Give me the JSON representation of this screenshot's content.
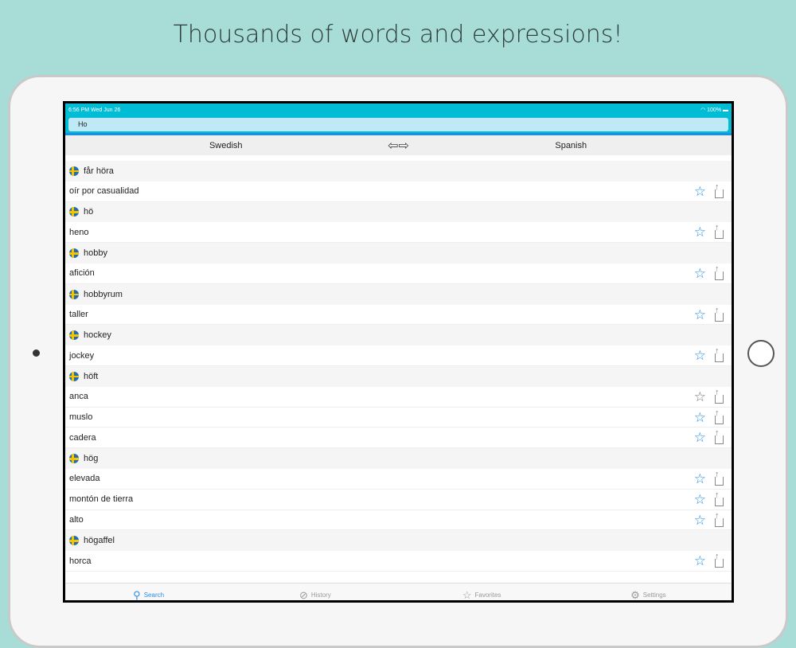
{
  "headline": "Thousands of words and expressions!",
  "status": {
    "time": "6:56 PM  Wed Jun 26",
    "battery": "100%"
  },
  "search": {
    "value": "Ho"
  },
  "languages": {
    "source": "Swedish",
    "target": "Spanish"
  },
  "entries": [
    {
      "word": "får höra",
      "translations": [
        {
          "text": "oír por casualidad",
          "fav": true
        }
      ]
    },
    {
      "word": "hö",
      "translations": [
        {
          "text": "heno",
          "fav": true
        }
      ]
    },
    {
      "word": "hobby",
      "translations": [
        {
          "text": "afición",
          "fav": true
        }
      ]
    },
    {
      "word": "hobbyrum",
      "translations": [
        {
          "text": "taller",
          "fav": true
        }
      ]
    },
    {
      "word": "hockey",
      "translations": [
        {
          "text": "jockey",
          "fav": true
        }
      ]
    },
    {
      "word": "höft",
      "translations": [
        {
          "text": "anca",
          "fav": false
        },
        {
          "text": "muslo",
          "fav": true
        },
        {
          "text": "cadera",
          "fav": true
        }
      ]
    },
    {
      "word": "hög",
      "translations": [
        {
          "text": "elevada",
          "fav": true
        },
        {
          "text": "montón de tierra",
          "fav": true
        },
        {
          "text": "alto",
          "fav": true
        }
      ]
    },
    {
      "word": "högaffel",
      "translations": [
        {
          "text": "horca",
          "fav": true
        }
      ]
    }
  ],
  "tabs": [
    {
      "label": "Search",
      "icon": "search-icon"
    },
    {
      "label": "History",
      "icon": "compass-icon"
    },
    {
      "label": "Favorites",
      "icon": "star-icon"
    },
    {
      "label": "Settings",
      "icon": "gear-icon"
    }
  ],
  "colors": {
    "accent": "#2a8ee8",
    "statusbar": "#00bcd4"
  }
}
